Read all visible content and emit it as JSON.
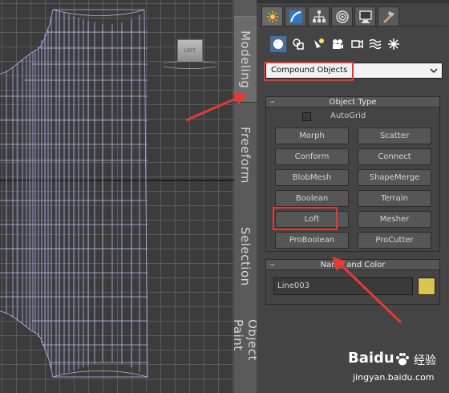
{
  "viewport": {
    "viewcube_label": "LEFT"
  },
  "ribbon": {
    "tabs": [
      {
        "label": "Modeling",
        "active": true
      },
      {
        "label": "Freeform"
      },
      {
        "label": "Selection"
      },
      {
        "label": "Object Paint"
      }
    ]
  },
  "command_panel": {
    "tabs": [
      {
        "name": "create-icon",
        "active": true
      },
      {
        "name": "modify-icon"
      },
      {
        "name": "hierarchy-icon"
      },
      {
        "name": "motion-icon"
      },
      {
        "name": "display-icon"
      },
      {
        "name": "utilities-icon"
      }
    ],
    "subcategories": [
      {
        "name": "geometry-icon",
        "active": true
      },
      {
        "name": "shapes-icon"
      },
      {
        "name": "lights-icon"
      },
      {
        "name": "cameras-icon"
      },
      {
        "name": "helpers-icon"
      },
      {
        "name": "space-warps-icon"
      },
      {
        "name": "systems-icon"
      }
    ],
    "category_dropdown": {
      "value": "Compound Objects"
    },
    "object_type": {
      "title": "Object Type",
      "autogrid_label": "AutoGrid",
      "autogrid_checked": false,
      "buttons": [
        "Morph",
        "Scatter",
        "Conform",
        "Connect",
        "BlobMesh",
        "ShapeMerge",
        "Boolean",
        "Terrain",
        "Loft",
        "Mesher",
        "ProBoolean",
        "ProCutter"
      ]
    },
    "name_and_color": {
      "title": "Name and Color",
      "name_value": "Line003",
      "color": "#d8c44e"
    }
  },
  "annotations": {
    "highlight_color": "#e53935"
  },
  "watermark": {
    "logo": "Bai",
    "logo2": "du",
    "cn": "经验",
    "url": "jingyan.baidu.com"
  }
}
